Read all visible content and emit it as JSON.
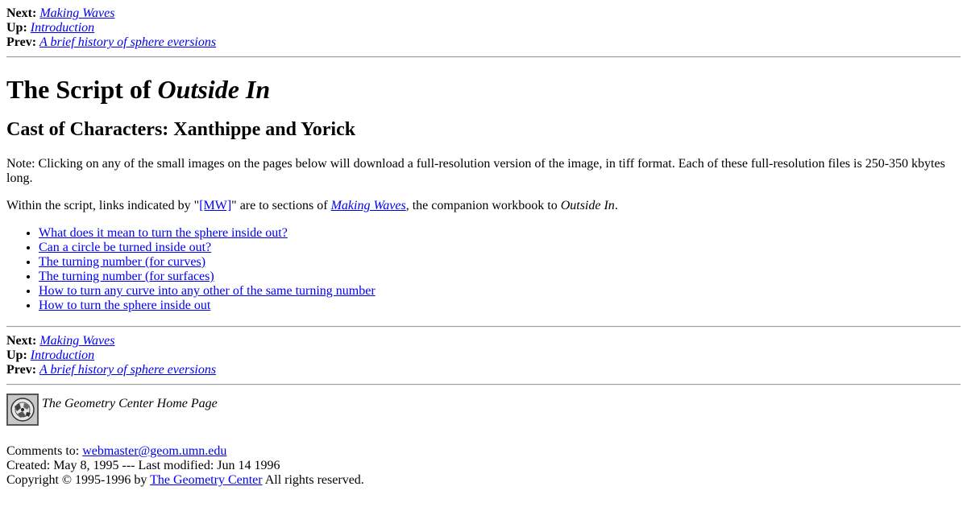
{
  "nav_top": {
    "next_label": "Next:",
    "next_link": "Making Waves",
    "up_label": "Up:",
    "up_link": "Introduction",
    "prev_label": "Prev:",
    "prev_link": "A brief history of sphere eversions"
  },
  "title": {
    "prefix": "The Script of ",
    "italic": "Outside In"
  },
  "subtitle": "Cast of Characters: Xanthippe and Yorick",
  "note": "Note: Clicking on any of the small images on the pages below will download a full-resolution version of the image, in tiff format. Each of these full-resolution files is 250-350 kbytes long.",
  "within": {
    "part1": "Within the script, links indicated by \"",
    "mw_link": "[MW]",
    "part2": "\" are to sections of ",
    "making_waves_link": "Making Waves",
    "part3": ", the companion workbook to ",
    "outside_in": "Outside In",
    "part4": "."
  },
  "toc": [
    "What does it mean to turn the sphere inside out?",
    "Can a circle be turned inside out?",
    "The turning number (for curves)",
    "The turning number (for surfaces)",
    "How to turn any curve into any other of the same turning number",
    "How to turn the sphere inside out"
  ],
  "nav_bottom": {
    "next_label": "Next:",
    "next_link": "Making Waves",
    "up_label": "Up:",
    "up_link": "Introduction",
    "prev_label": "Prev:",
    "prev_link": "A brief history of sphere eversions"
  },
  "home": {
    "icon": "geometry-center-logo-icon",
    "label": "The Geometry Center Home Page"
  },
  "footer": {
    "comments_label": "Comments to: ",
    "comments_email": "webmaster@geom.umn.edu",
    "created": "Created: May 8, 1995 --- Last modified: Jun 14 1996",
    "copyright_prefix": "Copyright © 1995-1996 by ",
    "copyright_link": "The Geometry Center",
    "copyright_suffix": " All rights reserved."
  },
  "colors": {
    "link": "#0000ee",
    "text": "#000000",
    "background": "#ffffff"
  }
}
